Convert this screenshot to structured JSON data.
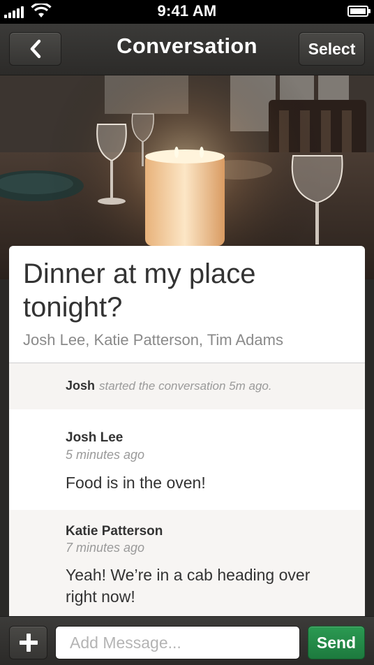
{
  "status_bar": {
    "time": "9:41 AM"
  },
  "nav": {
    "title": "Conversation",
    "select_label": "Select"
  },
  "conversation": {
    "title": "Dinner at my place tonight?",
    "participants": "Josh Lee, Katie Patterson, Tim Adams",
    "started": {
      "name": "Josh",
      "text": "started the conversation 5m ago."
    },
    "messages": [
      {
        "author": "Josh Lee",
        "time": "5 minutes ago",
        "text": "Food is in the oven!"
      },
      {
        "author": "Katie Patterson",
        "time": "7 minutes ago",
        "text": "Yeah!  We’re in a cab heading over right now!"
      }
    ]
  },
  "composer": {
    "placeholder": "Add Message...",
    "value": "",
    "send_label": "Send"
  },
  "colors": {
    "send_green": "#228a47",
    "bar_dark": "#333230"
  }
}
